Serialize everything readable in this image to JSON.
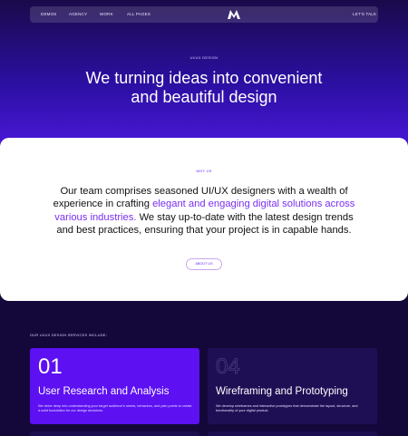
{
  "nav": {
    "items": [
      "DEMOS",
      "AGENCY",
      "WORK",
      "ALL PAGES"
    ],
    "cta": "LET'S TALK"
  },
  "hero": {
    "tag": "UI/UX DESIGN",
    "title_line1": "We turning ideas into convenient",
    "title_line2": "and beautiful design"
  },
  "about": {
    "tag": "WHY US",
    "text_part1": "Our team comprises seasoned UI/UX designers with a wealth of experience in crafting ",
    "highlight": "elegant and engaging digital solutions across various industries.",
    "text_part2": " We stay up-to-date with the latest design trends and best practices, ensuring that your project is in capable hands.",
    "button": "ABOUT US"
  },
  "services": {
    "label": "OUR UI/UX DESIGN SERVICES INCLUDE:",
    "items": [
      {
        "num": "01",
        "title": "User Research and Analysis",
        "desc": "We delve deep into understanding your target audience's needs, behaviors, and pain points to create a solid foundation for our design decisions."
      },
      {
        "num": "04",
        "title": "Wireframing and Prototyping",
        "desc": "We develop wireframes and interactive prototypes that demonstrate the layout, structure, and functionality of your digital product."
      }
    ]
  },
  "colors": {
    "accent": "#5d10f2",
    "highlight": "#7a2ff0",
    "background": "#14083a"
  }
}
